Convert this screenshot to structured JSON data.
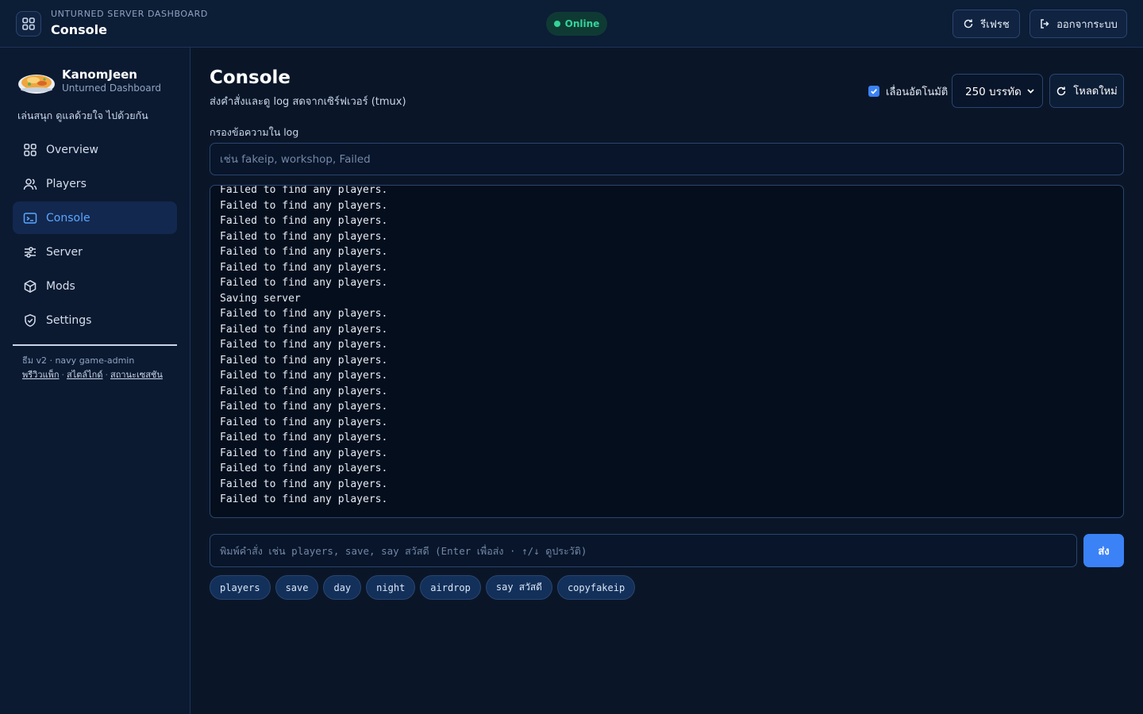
{
  "header": {
    "subtitle": "UNTURNED SERVER DASHBOARD",
    "title": "Console",
    "status": "Online",
    "refresh_label": "รีเฟรช",
    "logout_label": "ออกจากระบบ"
  },
  "sidebar": {
    "name": "KanomJeen",
    "sub": "Unturned Dashboard",
    "tagline": "เล่นสนุก ดูแลด้วยใจ ไปด้วยกัน",
    "items": [
      {
        "label": "Overview",
        "icon": "grid-icon"
      },
      {
        "label": "Players",
        "icon": "users-icon"
      },
      {
        "label": "Console",
        "icon": "terminal-icon",
        "active": true
      },
      {
        "label": "Server",
        "icon": "sliders-icon"
      },
      {
        "label": "Mods",
        "icon": "cube-icon"
      },
      {
        "label": "Settings",
        "icon": "shield-icon"
      }
    ],
    "version": "ธีม v2 · navy game-admin",
    "links": [
      "พรีวิวแพ็ก",
      "สไตล์ไกด์",
      "สถานะเซสชัน"
    ]
  },
  "main": {
    "title": "Console",
    "subtitle": "ส่งคำสั่งและดู log สดจากเซิร์ฟเวอร์ (tmux)",
    "autoscroll_label": "เลื่อนอัตโนมัติ",
    "autoscroll_checked": true,
    "lines_select": "250 บรรทัด",
    "reload_label": "โหลดใหม่",
    "filter_label": "กรองข้อความใน log",
    "filter_placeholder": "เช่น fakeip, workshop, Failed",
    "log_lines": [
      "Failed to find any players.",
      "Failed to find any players.",
      "Failed to find any players.",
      "Failed to find any players.",
      "Failed to find any players.",
      "Failed to find any players.",
      "Failed to find any players.",
      "Saving server",
      "Failed to find any players.",
      "Failed to find any players.",
      "Failed to find any players.",
      "Failed to find any players.",
      "Failed to find any players.",
      "Failed to find any players.",
      "Failed to find any players.",
      "Failed to find any players.",
      "Failed to find any players.",
      "Failed to find any players.",
      "Failed to find any players.",
      "Failed to find any players.",
      "Failed to find any players."
    ],
    "command_placeholder": "พิมพ์คำสั่ง เช่น players, save, say สวัสดี (Enter เพื่อส่ง · ↑/↓ ดูประวัติ)",
    "send_label": "ส่ง",
    "quick_commands": [
      "players",
      "save",
      "day",
      "night",
      "airdrop",
      "say สวัสดี",
      "copyfakeip"
    ]
  },
  "colors": {
    "accent": "#3b82f6",
    "online": "#34d399",
    "background": "#0a1628"
  }
}
